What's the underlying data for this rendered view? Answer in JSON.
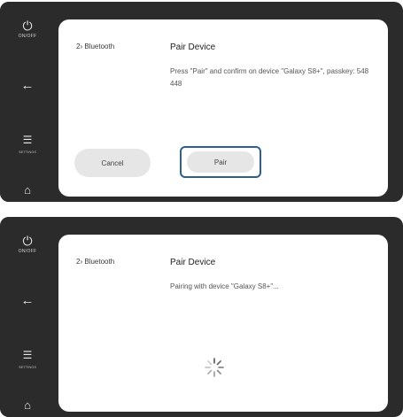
{
  "screens": [
    {
      "sidebar": {
        "power_icon": "power-icon",
        "power_label": "ON/OFF",
        "back_icon": "back-arrow-icon",
        "settings_icon": "sliders-icon",
        "settings_label": "SETTINGS",
        "home_icon": "home-icon"
      },
      "breadcrumb": "2› Bluetooth",
      "title": "Pair Device",
      "message": "Press \"Pair\" and confirm on device \"Galaxy S8+\", passkey: 548 448",
      "buttons": {
        "cancel": "Cancel",
        "pair": "Pair"
      },
      "accent_color": "#2f5f8f"
    },
    {
      "sidebar": {
        "power_icon": "power-icon",
        "power_label": "ON/OFF",
        "back_icon": "back-arrow-icon",
        "settings_icon": "sliders-icon",
        "settings_label": "SETTINGS",
        "home_icon": "home-icon"
      },
      "breadcrumb": "2› Bluetooth",
      "title": "Pair Device",
      "message": "Pairing with device \"Galaxy S8+\"...",
      "spinner_icon": "loading-spinner-icon"
    }
  ]
}
